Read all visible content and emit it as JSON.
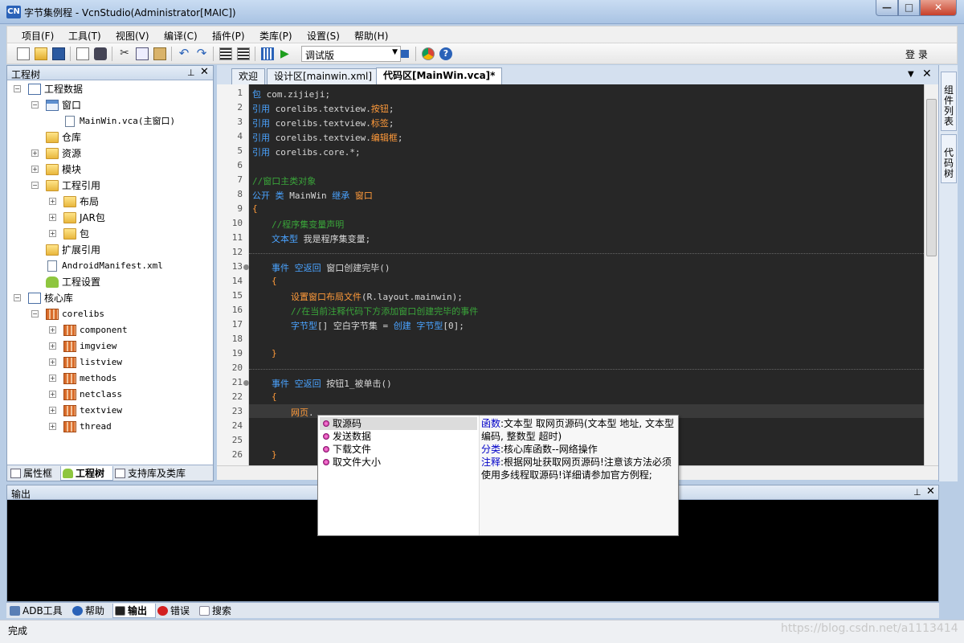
{
  "window": {
    "title": "字节集例程 - VcnStudio(Administrator[MAIC])",
    "app_icon_text": "CN"
  },
  "menu": [
    "项目(F)",
    "工具(T)",
    "视图(V)",
    "编译(C)",
    "插件(P)",
    "类库(P)",
    "设置(S)",
    "帮助(H)"
  ],
  "toolbar": {
    "build_config": "调试版",
    "login_label": "登 录"
  },
  "project_tree": {
    "title": "工程树",
    "nodes": [
      {
        "label": "工程数据"
      },
      {
        "label": "窗口"
      },
      {
        "label": "MainWin.vca(主窗口)"
      },
      {
        "label": "仓库"
      },
      {
        "label": "资源"
      },
      {
        "label": "模块"
      },
      {
        "label": "工程引用"
      },
      {
        "label": "布局"
      },
      {
        "label": "JAR包"
      },
      {
        "label": "包"
      },
      {
        "label": "扩展引用"
      },
      {
        "label": "AndroidManifest.xml"
      },
      {
        "label": "工程设置"
      },
      {
        "label": "核心库"
      },
      {
        "label": "corelibs"
      },
      {
        "label": "component"
      },
      {
        "label": "imgview"
      },
      {
        "label": "listview"
      },
      {
        "label": "methods"
      },
      {
        "label": "netclass"
      },
      {
        "label": "textview"
      },
      {
        "label": "thread"
      }
    ],
    "tabs": [
      "属性框",
      "工程树",
      "支持库及类库"
    ]
  },
  "doc_tabs": [
    "欢迎",
    "设计区[mainwin.xml]",
    "代码区[MainWin.vca]*"
  ],
  "code": {
    "line_numbers": [
      "1",
      "2",
      "3",
      "4",
      "5",
      "6",
      "7",
      "8",
      "9",
      "10",
      "11",
      "12",
      "13",
      "14",
      "15",
      "16",
      "17",
      "18",
      "19",
      "20",
      "21",
      "22",
      "23",
      "24",
      "25",
      "26"
    ],
    "lines": {
      "l1": [
        "包",
        " com.zijieji;"
      ],
      "l2": [
        "引用",
        " corelibs.textview.",
        "按钮",
        ";"
      ],
      "l3": [
        "引用",
        " corelibs.textview.",
        "标签",
        ";"
      ],
      "l4": [
        "引用",
        " corelibs.textview.",
        "编辑框",
        ";"
      ],
      "l5": [
        "引用",
        " corelibs.core.*;"
      ],
      "l7": "//窗口主类对象",
      "l8": [
        "公开",
        " ",
        "类",
        " MainWin ",
        "继承",
        " ",
        "窗口"
      ],
      "l9": "{",
      "l10": "//程序集变量声明",
      "l11": [
        "文本型",
        " 我是程序集变量;"
      ],
      "l13": [
        "事件",
        " ",
        "空返回",
        " 窗口创建完毕()"
      ],
      "l14": "{",
      "l15": [
        "设置窗口布局文件",
        "(R.layout.mainwin);"
      ],
      "l16": "//在当前注释代码下方添加窗口创建完毕的事件",
      "l17": [
        "字节型",
        "[] 空白字节集 = ",
        "创建",
        " ",
        "字节型",
        "[0];"
      ],
      "l19": "}",
      "l21": [
        "事件",
        " ",
        "空返回",
        " 按钮1_被单击()"
      ],
      "l22": "{",
      "l23": [
        "网页",
        "."
      ],
      "l26": "}"
    }
  },
  "autocomplete": {
    "items": [
      "取源码",
      "发送数据",
      "下载文件",
      "取文件大小"
    ],
    "desc": {
      "func_label": "函数",
      "func_text": ":文本型 取网页源码(文本型 地址, 文本型 编码, 整数型 超时)",
      "cat_label": "分类",
      "cat_text": ":核心库函数--网络操作",
      "note_label": "注释",
      "note_text": ":根据网址获取网页源码!注意该方法必须使用多线程取源码!详细请参加官方例程;"
    }
  },
  "right_tabs": [
    "组件列表",
    "代码树"
  ],
  "output": {
    "title": "输出"
  },
  "bottom_tabs": [
    "ADB工具",
    "帮助",
    "输出",
    "错误",
    "搜索"
  ],
  "status": {
    "text": "完成",
    "watermark": "https://blog.csdn.net/a1113414"
  }
}
